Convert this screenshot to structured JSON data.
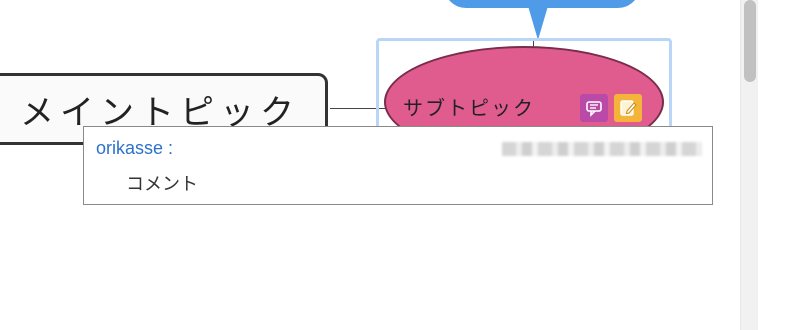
{
  "mindmap": {
    "main_topic": {
      "label": "メイントピック"
    },
    "sub_topic": {
      "label": "サブトピック"
    },
    "icons": {
      "comment": "comment-icon",
      "note": "note-icon"
    },
    "colors": {
      "callout": "#4f9be8",
      "sub_topic_fill": "#e05c8e",
      "selection": "#b9d5f7",
      "comment_icon": "#b94aa8",
      "note_icon": "#f4b43a",
      "author": "#2b72c9"
    }
  },
  "comment_tooltip": {
    "author": "orikasse :",
    "text": "コメント"
  }
}
